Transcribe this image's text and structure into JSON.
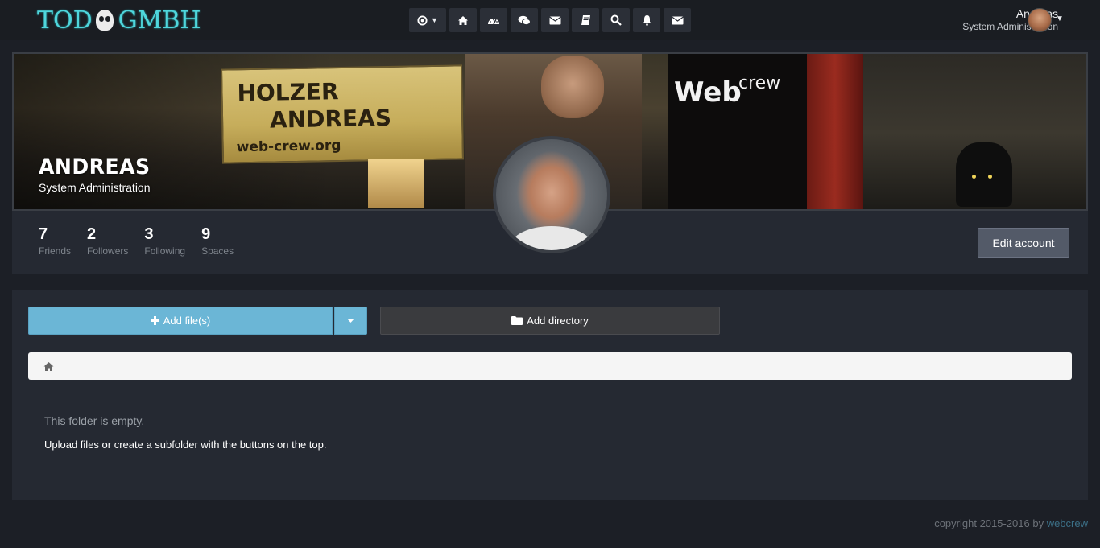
{
  "app": {
    "logo_text_left": "TOD",
    "logo_text_right": "GMBH",
    "accent_color": "#4fd6dc"
  },
  "topnav": {
    "icons": [
      "settings-icon",
      "home-icon",
      "dashboard-icon",
      "chat-icon",
      "mail-icon",
      "book-icon",
      "search-icon",
      "bell-icon",
      "envelope-icon"
    ]
  },
  "user": {
    "name": "Andreas",
    "role": "System Administration"
  },
  "profile": {
    "name": "ANDREAS",
    "role": "System Administration",
    "banner": {
      "sign_line1": "HOLZER",
      "sign_line2": "ANDREAS",
      "sign_url": "web-crew.org",
      "crew_word": "crew",
      "web_word": "Web"
    },
    "stats": [
      {
        "value": "7",
        "label": "Friends"
      },
      {
        "value": "2",
        "label": "Followers"
      },
      {
        "value": "3",
        "label": "Following"
      },
      {
        "value": "9",
        "label": "Spaces"
      }
    ],
    "edit_label": "Edit account"
  },
  "files": {
    "add_files_label": "Add file(s)",
    "add_directory_label": "Add directory",
    "empty_title": "This folder is empty.",
    "empty_desc": "Upload files or create a subfolder with the buttons on the top."
  },
  "footer": {
    "text": "copyright 2015-2016 by",
    "link": "webcrew"
  }
}
